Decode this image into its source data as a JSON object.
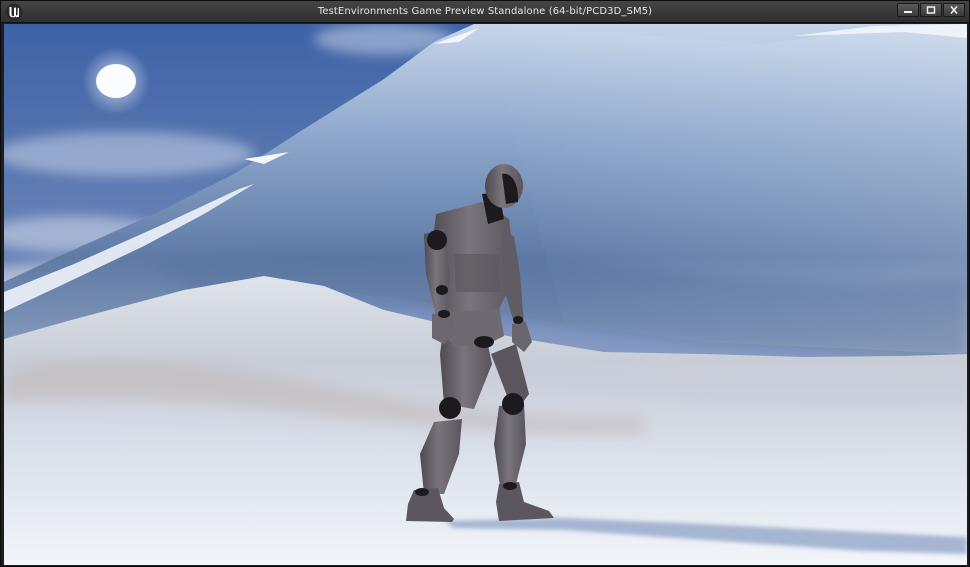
{
  "window": {
    "title": "TestEnvironments Game Preview Standalone (64-bit/PCD3D_SM5)",
    "app_icon": "unreal-engine-logo",
    "controls": [
      {
        "name": "minimize",
        "icon": "minimize-icon"
      },
      {
        "name": "maximize",
        "icon": "maximize-icon"
      },
      {
        "name": "close",
        "icon": "close-icon"
      }
    ]
  },
  "viewport": {
    "content": "3d-game-scene",
    "colors": {
      "sky_top": "#3f64a8",
      "sky_bottom": "#b7c3d8",
      "mountain": "#7f9cc6",
      "snow": "#e3e9f1",
      "mannequin": "#6e6a70"
    }
  }
}
